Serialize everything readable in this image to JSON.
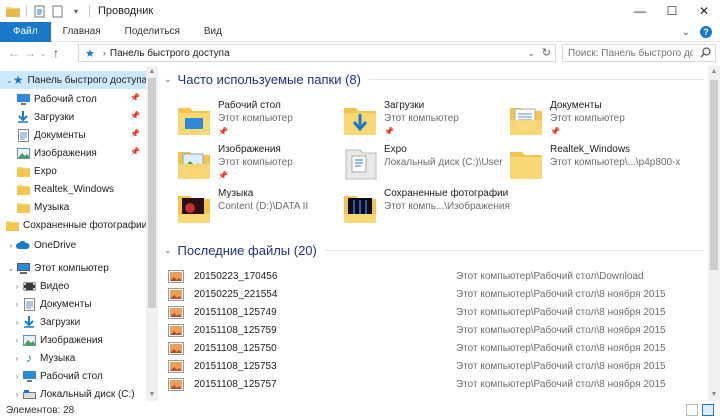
{
  "window": {
    "title": "Проводник",
    "controls": [
      "—",
      "☐",
      "✕"
    ]
  },
  "ribbon": {
    "tabs": [
      "Файл",
      "Главная",
      "Поделиться",
      "Вид"
    ]
  },
  "address": {
    "path": "Панель быстрого доступа",
    "search_placeholder": "Поиск: Панель быстрого до..."
  },
  "nav": {
    "items": [
      {
        "label": "Панель быстрого доступа",
        "icon": "star-icon",
        "selected": true
      },
      {
        "label": "Рабочий стол",
        "icon": "desktop-icon",
        "pinned": true
      },
      {
        "label": "Загрузки",
        "icon": "download-icon",
        "pinned": true
      },
      {
        "label": "Документы",
        "icon": "documents-icon",
        "pinned": true
      },
      {
        "label": "Изображения",
        "icon": "pictures-icon",
        "pinned": true
      },
      {
        "label": "Expo",
        "icon": "folder-icon"
      },
      {
        "label": "Realtek_Windows",
        "icon": "folder-icon"
      },
      {
        "label": "Музыка",
        "icon": "folder-icon"
      },
      {
        "label": "Сохраненные фотографии",
        "icon": "folder-icon"
      },
      {
        "label": "OneDrive",
        "icon": "onedrive-icon"
      },
      {
        "label": "Этот компьютер",
        "icon": "computer-icon"
      },
      {
        "label": "Видео",
        "icon": "video-icon"
      },
      {
        "label": "Документы",
        "icon": "documents-icon"
      },
      {
        "label": "Загрузки",
        "icon": "download-icon"
      },
      {
        "label": "Изображения",
        "icon": "pictures-icon"
      },
      {
        "label": "Музыка",
        "icon": "music-icon"
      },
      {
        "label": "Рабочий стол",
        "icon": "desktop-icon"
      },
      {
        "label": "Локальный диск (C:)",
        "icon": "drive-icon"
      }
    ]
  },
  "frequent": {
    "header": "Часто используемые папки (8)",
    "folders": [
      {
        "name": "Рабочий стол",
        "location": "Этот компьютер",
        "pinned": true
      },
      {
        "name": "Загрузки",
        "location": "Этот компьютер",
        "pinned": true
      },
      {
        "name": "Документы",
        "location": "Этот компьютер",
        "pinned": true
      },
      {
        "name": "Изображения",
        "location": "Этот компьютер",
        "pinned": true
      },
      {
        "name": "Expo",
        "location": "Локальный диск (C:)\\User",
        "pinned": false
      },
      {
        "name": "Realtek_Windows",
        "location": "Этот компьютер\\...\\p4p800-x",
        "pinned": false
      },
      {
        "name": "Музыка",
        "location": "Content (D:)\\DATA II",
        "pinned": false
      },
      {
        "name": "Сохраненные фотографии",
        "location": "Этот компь...\\Изображения",
        "pinned": false
      }
    ]
  },
  "recent": {
    "header": "Последние файлы (20)",
    "files": [
      {
        "name": "20150223_170456",
        "location": "Этот компьютер\\Рабочий стол\\Download"
      },
      {
        "name": "20150225_221554",
        "location": "Этот компьютер\\Рабочий стол\\8 ноября 2015"
      },
      {
        "name": "20151108_125749",
        "location": "Этот компьютер\\Рабочий стол\\8 ноября 2015"
      },
      {
        "name": "20151108_125759",
        "location": "Этот компьютер\\Рабочий стол\\8 ноября 2015"
      },
      {
        "name": "20151108_125750",
        "location": "Этот компьютер\\Рабочий стол\\8 ноября 2015"
      },
      {
        "name": "20151108_125753",
        "location": "Этот компьютер\\Рабочий стол\\8 ноября 2015"
      },
      {
        "name": "20151108_125757",
        "location": "Этот компьютер\\Рабочий стол\\8 ноября 2015"
      }
    ]
  },
  "status": {
    "count": "Элементов: 28"
  },
  "colors": {
    "accent": "#1979ca",
    "folder": "#f8d775",
    "header_text": "#1e3287",
    "selection": "#cce8ff"
  }
}
